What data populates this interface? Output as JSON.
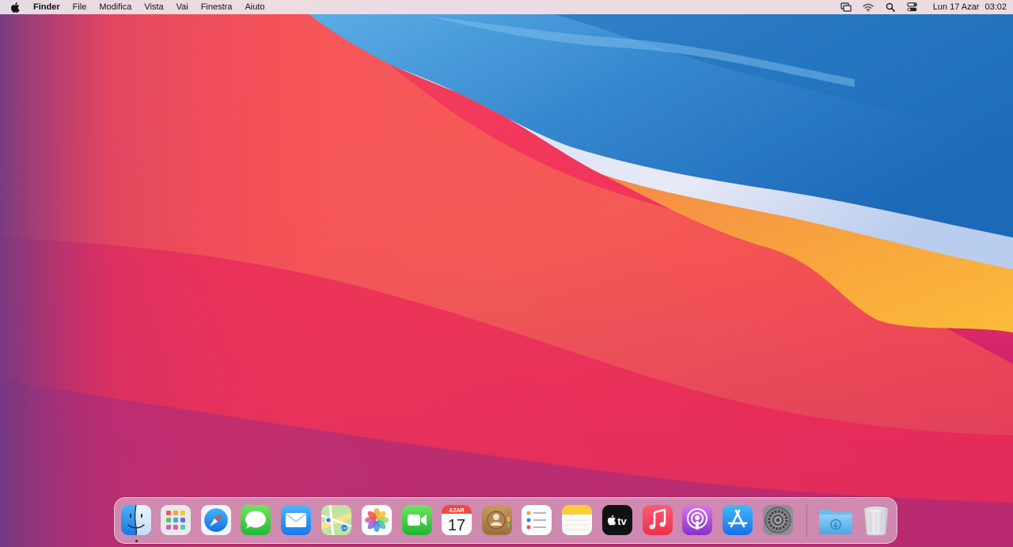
{
  "menubar": {
    "app_name": "Finder",
    "menus": [
      "File",
      "Modifica",
      "Vista",
      "Vai",
      "Finestra",
      "Aiuto"
    ],
    "status_icons": [
      "screen-mirroring-icon",
      "wifi-icon",
      "spotlight-search-icon",
      "control-center-icon"
    ],
    "clock": {
      "date": "Lun 17 Azar",
      "time": "03:02"
    }
  },
  "dock": {
    "apps": [
      {
        "name": "finder-icon",
        "running": true
      },
      {
        "name": "launchpad-icon",
        "running": false
      },
      {
        "name": "safari-icon",
        "running": false
      },
      {
        "name": "messages-icon",
        "running": false
      },
      {
        "name": "mail-icon",
        "running": false
      },
      {
        "name": "maps-icon",
        "running": false
      },
      {
        "name": "photos-icon",
        "running": false
      },
      {
        "name": "facetime-icon",
        "running": false
      },
      {
        "name": "calendar-icon",
        "running": false
      },
      {
        "name": "contacts-icon",
        "running": false
      },
      {
        "name": "reminders-icon",
        "running": false
      },
      {
        "name": "notes-icon",
        "running": false
      },
      {
        "name": "apple-tv-icon",
        "running": false
      },
      {
        "name": "music-icon",
        "running": false
      },
      {
        "name": "podcasts-icon",
        "running": false
      },
      {
        "name": "app-store-icon",
        "running": false
      },
      {
        "name": "system-preferences-icon",
        "running": false
      }
    ],
    "calendar": {
      "month": "AZAR",
      "day": "17"
    },
    "tv_label": "tv",
    "others": [
      "downloads-folder-icon",
      "trash-icon"
    ]
  },
  "colors": {
    "menubar_bg": "#ECE8EC",
    "wallpaper_red": "#F2284E",
    "wallpaper_blue": "#2A7DC8",
    "wallpaper_orange": "#F7A23A"
  }
}
